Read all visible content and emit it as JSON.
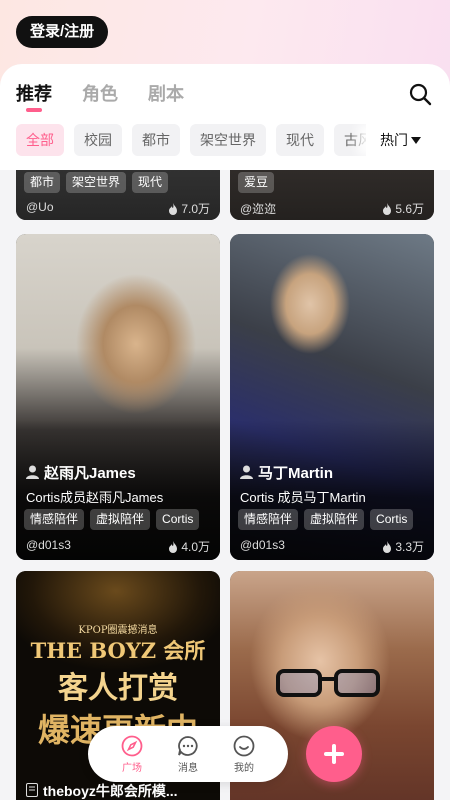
{
  "header": {
    "login_label": "登录/注册"
  },
  "tabs": [
    {
      "label": "推荐",
      "active": true
    },
    {
      "label": "角色",
      "active": false
    },
    {
      "label": "剧本",
      "active": false
    }
  ],
  "filters": [
    "全部",
    "校园",
    "都市",
    "架空世界",
    "现代",
    "古风"
  ],
  "sort_label": "热门",
  "cards": [
    {
      "tags": [
        "都市",
        "架空世界",
        "现代"
      ],
      "author": "@Uo",
      "likes": "7.0万"
    },
    {
      "tags": [
        "爱豆"
      ],
      "author": "@迩迩",
      "likes": "5.6万"
    },
    {
      "name": "赵雨凡James",
      "desc": "Cortis成员赵雨凡James",
      "tags": [
        "情感陪伴",
        "虚拟陪伴",
        "Cortis"
      ],
      "author": "@d01s3",
      "likes": "4.0万"
    },
    {
      "name": "马丁Martin",
      "desc": "Cortis 成员马丁Martin",
      "tags": [
        "情感陪伴",
        "虚拟陪伴",
        "Cortis"
      ],
      "author": "@d01s3",
      "likes": "3.3万"
    },
    {
      "name": "theboyz牛郎会所模...",
      "poster": {
        "top": "KPOP圈震撼消息",
        "title": "THE BOYZ 会所",
        "line2": "客人打赏",
        "line3": "爆速更新中"
      }
    },
    {
      "name": ""
    }
  ],
  "bottom_nav": [
    {
      "label": "广场",
      "icon": "compass-icon",
      "active": true
    },
    {
      "label": "消息",
      "icon": "chat-bubble-icon",
      "active": false
    },
    {
      "label": "我的",
      "icon": "smiley-icon",
      "active": false
    }
  ],
  "colors": {
    "accent": "#ff5e8c",
    "login_bg": "#111111"
  }
}
